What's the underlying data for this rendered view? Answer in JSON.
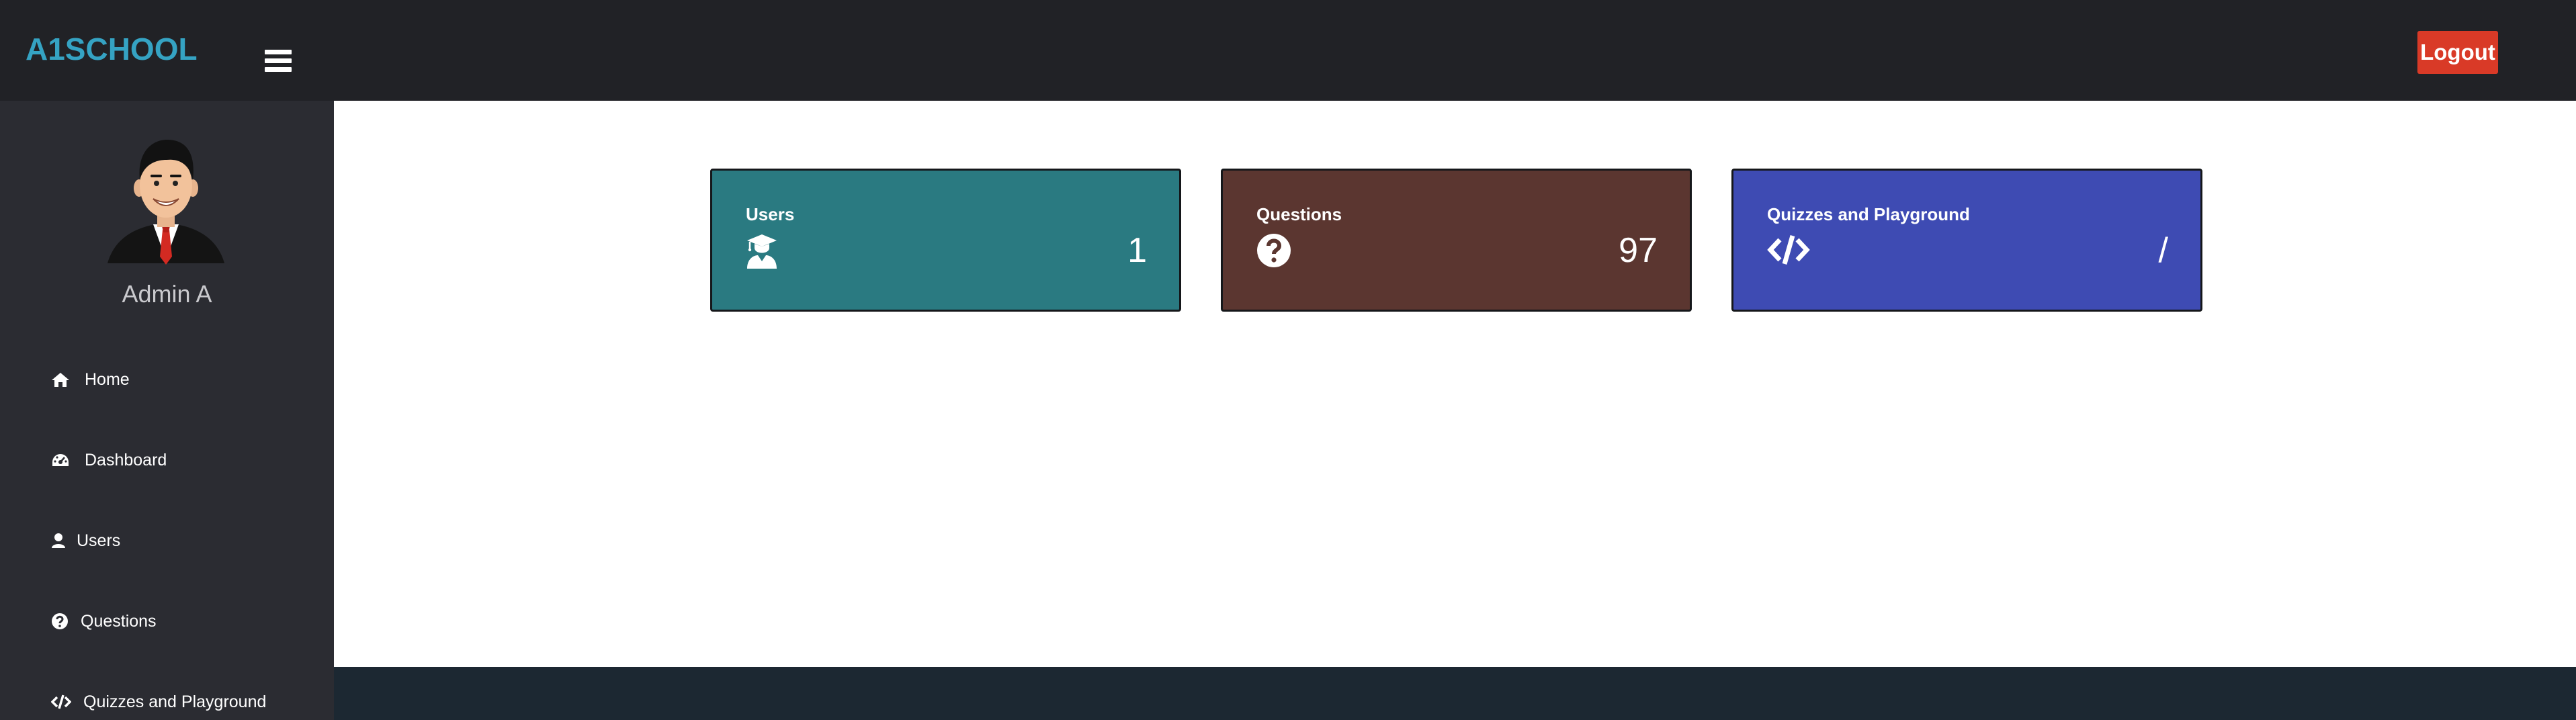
{
  "app": {
    "brand": "A1SCHOOL",
    "logout_label": "Logout"
  },
  "colors": {
    "topbar": "#212226",
    "sidebar": "#2b2c32",
    "brand": "#35a3c3",
    "logout": "#d93a27",
    "footer": "#1c2832"
  },
  "sidebar": {
    "user_name": "Admin A",
    "items": [
      {
        "label": "Home",
        "icon": "home-icon"
      },
      {
        "label": "Dashboard",
        "icon": "dashboard-icon"
      },
      {
        "label": "Users",
        "icon": "user-icon"
      },
      {
        "label": "Questions",
        "icon": "question-circle-icon"
      },
      {
        "label": "Quizzes and Playground",
        "icon": "code-icon"
      }
    ]
  },
  "cards": [
    {
      "title": "Users",
      "value": "1",
      "icon": "graduate-icon",
      "color": "#2a7a81"
    },
    {
      "title": "Questions",
      "value": "97",
      "icon": "question-circle-icon",
      "color": "#5b3630"
    },
    {
      "title": "Quizzes and Playground",
      "value": "/",
      "icon": "code-icon",
      "color": "#3e4bb3"
    }
  ]
}
